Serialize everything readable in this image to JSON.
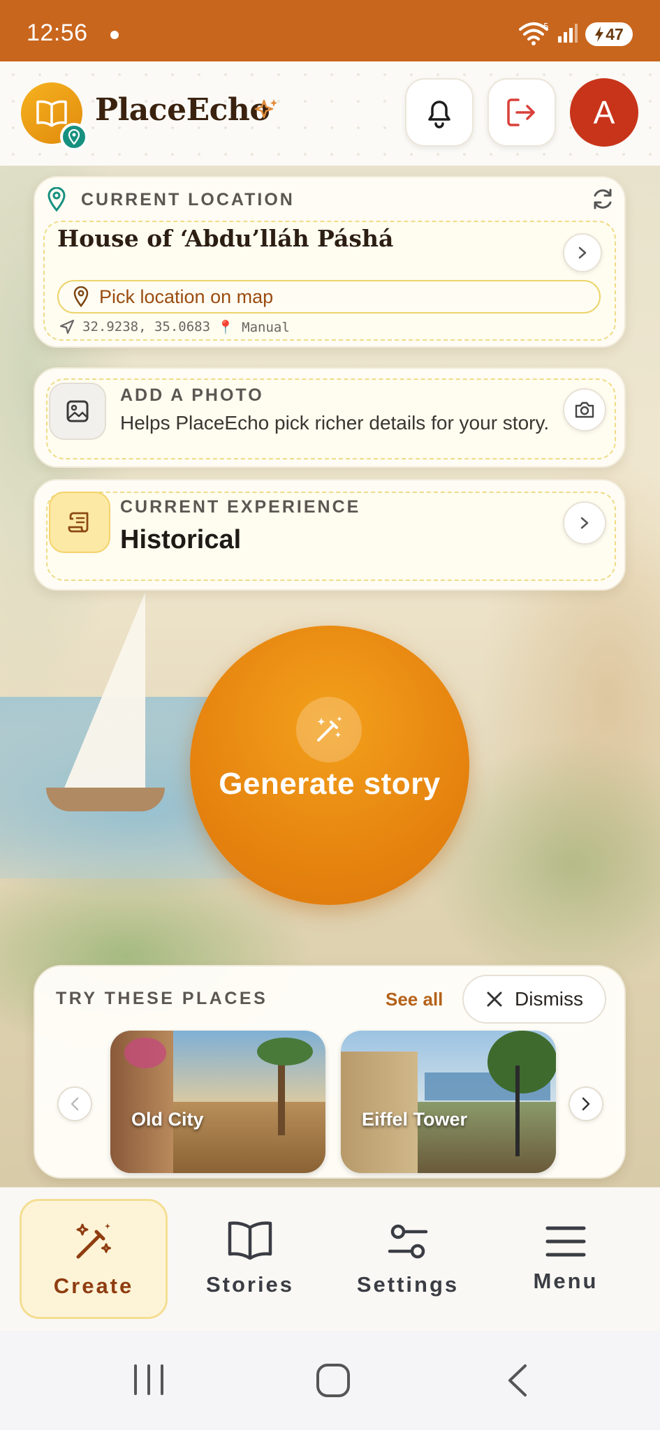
{
  "status_bar": {
    "time": "12:56",
    "wifi_badge": "5",
    "battery": "47"
  },
  "header": {
    "app_name": "PlaceEcho",
    "avatar_letter": "A",
    "icons": [
      "book-open-icon",
      "map-pin-icon",
      "sparkle-icon",
      "bell-icon",
      "logout-icon"
    ]
  },
  "location": {
    "label": "CURRENT LOCATION",
    "place_name": "House of ‘Abdu’lláh Páshá",
    "pick_on_map": "Pick location on map",
    "coordinates": "32.9238, 35.0683",
    "source": "📍 Manual"
  },
  "photo": {
    "label": "ADD A PHOTO",
    "description": "Helps PlaceEcho pick richer details for your story."
  },
  "experience": {
    "label": "CURRENT EXPERIENCE",
    "value": "Historical"
  },
  "generate": {
    "label": "Generate story"
  },
  "suggestions": {
    "label": "TRY THESE PLACES",
    "see_all": "See all",
    "dismiss": "Dismiss",
    "places": [
      {
        "name": "Old City"
      },
      {
        "name": "Eiffel Tower"
      }
    ]
  },
  "bottom_nav": {
    "active": "Create",
    "tabs": [
      {
        "label": "Create"
      },
      {
        "label": "Stories"
      },
      {
        "label": "Settings"
      },
      {
        "label": "Menu"
      }
    ]
  },
  "colors": {
    "status_bar": "#c9661d",
    "accent_orange": "#e6840f",
    "brand_text": "#3a220f",
    "pin_teal": "#16907f",
    "avatar_red": "#c8341a",
    "active_tab_bg": "#fdf4d8"
  }
}
